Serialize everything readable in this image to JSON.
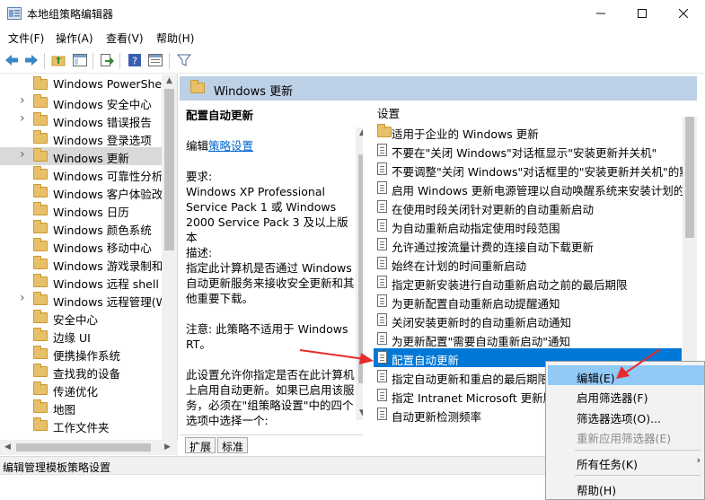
{
  "window": {
    "title": "本地组策略编辑器"
  },
  "menu": [
    "文件(F)",
    "操作(A)",
    "查看(V)",
    "帮助(H)"
  ],
  "tree": [
    {
      "label": "Windows PowerShell",
      "expandable": false
    },
    {
      "label": "Windows 安全中心",
      "expandable": true
    },
    {
      "label": "Windows 错误报告",
      "expandable": true
    },
    {
      "label": "Windows 登录选项",
      "expandable": false
    },
    {
      "label": "Windows 更新",
      "expandable": true,
      "selected": true
    },
    {
      "label": "Windows 可靠性分析",
      "expandable": false
    },
    {
      "label": "Windows 客户体验改善",
      "expandable": false
    },
    {
      "label": "Windows 日历",
      "expandable": false
    },
    {
      "label": "Windows 颜色系统",
      "expandable": false
    },
    {
      "label": "Windows 移动中心",
      "expandable": false
    },
    {
      "label": "Windows 游戏录制和广播",
      "expandable": false
    },
    {
      "label": "Windows 远程 shell",
      "expandable": false
    },
    {
      "label": "Windows 远程管理(WinRM)",
      "expandable": true
    },
    {
      "label": "安全中心",
      "expandable": false
    },
    {
      "label": "边缘 UI",
      "expandable": false
    },
    {
      "label": "便携操作系统",
      "expandable": false
    },
    {
      "label": "查找我的设备",
      "expandable": false
    },
    {
      "label": "传递优化",
      "expandable": false
    },
    {
      "label": "地图",
      "expandable": false
    },
    {
      "label": "工作文件夹",
      "expandable": false
    }
  ],
  "pane": {
    "header": "Windows 更新",
    "policy_title": "配置自动更新",
    "edit_prefix": "编辑",
    "edit_link": "策略设置",
    "req_label": "要求:",
    "req_text": "Windows XP Professional Service Pack 1 或 Windows 2000 Service Pack 3 及以上版本",
    "desc_label": "描述:",
    "desc_text": "指定此计算机是否通过 Windows 自动更新服务来接收安全更新和其他重要下载。",
    "note_text": "注意: 此策略不适用于 Windows RT。",
    "more_text": "此设置允许你指定是否在此计算机上启用自动更新。如果已启用该服务，必须在\"组策略设置\"中的四个选项中选择一个:"
  },
  "list": {
    "column": "设置",
    "rows": [
      {
        "label": "适用于企业的 Windows 更新",
        "kind": "folder"
      },
      {
        "label": "不要在\"关闭 Windows\"对话框显示\"安装更新并关机\"",
        "kind": "policy"
      },
      {
        "label": "不要调整\"关闭 Windows\"对话框里的\"安装更新并关机\"的默认",
        "kind": "policy"
      },
      {
        "label": "启用 Windows 更新电源管理以自动唤醒系统来安装计划的更新",
        "kind": "policy"
      },
      {
        "label": "在使用时段关闭针对更新的自动重新启动",
        "kind": "policy"
      },
      {
        "label": "为自动重新启动指定使用时段范围",
        "kind": "policy"
      },
      {
        "label": "允许通过按流量计费的连接自动下载更新",
        "kind": "policy"
      },
      {
        "label": "始终在计划的时间重新启动",
        "kind": "policy"
      },
      {
        "label": "指定更新安装进行自动重新启动之前的最后期限",
        "kind": "policy"
      },
      {
        "label": "为更新配置自动重新启动提醒通知",
        "kind": "policy"
      },
      {
        "label": "关闭安装更新时的自动重新启动通知",
        "kind": "policy"
      },
      {
        "label": "为更新配置\"需要自动重新启动\"通知",
        "kind": "policy"
      },
      {
        "label": "配置自动更新",
        "kind": "policy",
        "selected": true
      },
      {
        "label": "指定自动更新和重启的最后期限",
        "kind": "policy"
      },
      {
        "label": "指定 Intranet Microsoft 更新服务位置",
        "kind": "policy"
      },
      {
        "label": "自动更新检测频率",
        "kind": "policy"
      }
    ]
  },
  "tabs": [
    "扩展",
    "标准"
  ],
  "status": "编辑管理模板策略设置",
  "context_menu": [
    {
      "label": "编辑(E)",
      "hover": true
    },
    {
      "label": "启用筛选器(F)"
    },
    {
      "label": "筛选器选项(O)..."
    },
    {
      "label": "重新应用筛选器(E)",
      "disabled": true
    },
    {
      "label": "所有任务(K)",
      "submenu": true
    },
    {
      "label": "帮助(H)"
    }
  ],
  "colors": {
    "accent": "#0078d7",
    "annotation": "#e52b2b",
    "header_band": "#bcd0e6"
  }
}
